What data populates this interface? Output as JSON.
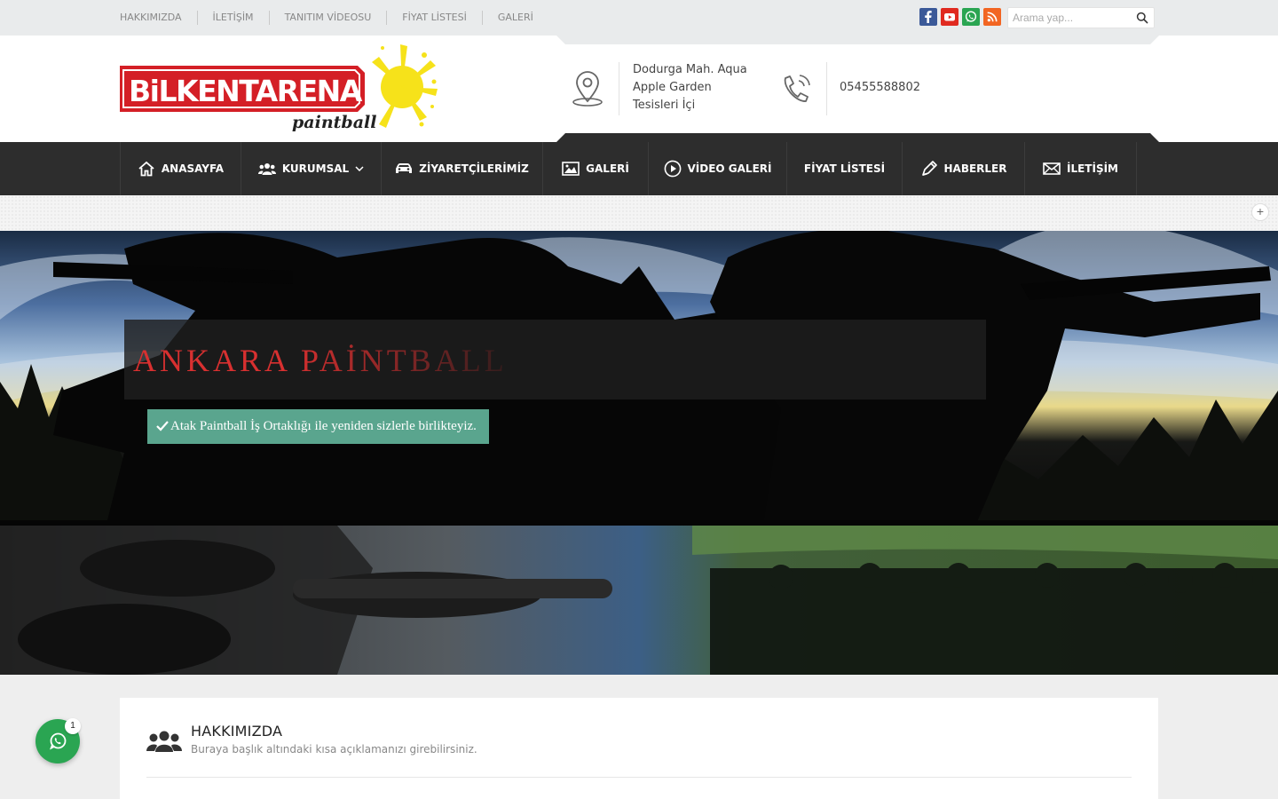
{
  "topbar": {
    "links": [
      "HAKKIMIZDA",
      "İLETİŞİM",
      "TANITIM VİDEOSU",
      "FİYAT LİSTESİ",
      "GALERİ"
    ],
    "socials": [
      {
        "icon": "facebook-icon",
        "color": "#3b5998"
      },
      {
        "icon": "youtube-icon",
        "color": "#e02a20"
      },
      {
        "icon": "whatsapp-icon",
        "color": "#2aa552"
      },
      {
        "icon": "rss-icon",
        "color": "#f26522"
      }
    ],
    "search": {
      "placeholder": "Arama yap...",
      "value": ""
    }
  },
  "header": {
    "logo": {
      "text": "BiLKENTARENA",
      "tagline": "paintball"
    },
    "address": "Dodurga Mah. Aqua Apple Garden Tesisleri İçi",
    "phone": "05455588802"
  },
  "nav": {
    "items": [
      {
        "label": "ANASAYFA",
        "icon": "home-icon"
      },
      {
        "label": "KURUMSAL",
        "icon": "users-icon",
        "dropdown": true
      },
      {
        "label": "ZİYARETÇİLERİMİZ",
        "icon": "car-icon"
      },
      {
        "label": "GALERİ",
        "icon": "image-icon"
      },
      {
        "label": "VİDEO GALERİ",
        "icon": "play-icon"
      },
      {
        "label": "FİYAT LİSTESİ",
        "icon": ""
      },
      {
        "label": "HABERLER",
        "icon": "pen-icon"
      },
      {
        "label": "İLETİŞİM",
        "icon": "mail-icon"
      }
    ]
  },
  "slider": {
    "title": "ANKARA PAİNTBALL",
    "subtitle": "Atak Paintball İş Ortaklığı ile yeniden sizlerle birlikteyiz."
  },
  "section": {
    "title": "HAKKIMIZDA",
    "subtitle": "Buraya başlık altındaki kısa açıklamanızı girebilirsiniz."
  },
  "whatsapp": {
    "badge": "1"
  },
  "colors": {
    "accent": "#c62828",
    "nav_bg": "#2d2d2d",
    "caption_green": "#5aa58e",
    "whatsapp": "#2aa552"
  }
}
